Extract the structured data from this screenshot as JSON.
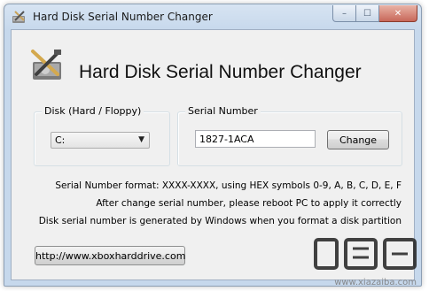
{
  "window": {
    "title": "Hard Disk Serial Number Changer",
    "controls": {
      "minimize": "–",
      "maximize": "☐",
      "close": "✕"
    }
  },
  "header": {
    "app_title": "Hard Disk Serial Number Changer",
    "icon": "hard-disk-tool-icon"
  },
  "drive_group": {
    "label": "Disk (Hard / Floppy)",
    "selected": "C:",
    "icon": "chevron-down-icon"
  },
  "serial_group": {
    "label": "Serial Number",
    "value": "1827-1ACA",
    "change_label": "Change"
  },
  "info": {
    "line1": "Serial Number format: XXXX-XXXX, using HEX symbols 0-9, A, B, C, D, E, F",
    "line2": "After change serial number, please reboot PC to apply it correctly",
    "line3": "Disk serial number is generated by Windows when you format a disk partition"
  },
  "footer": {
    "url_label": "http://www.xboxharddrive.com"
  },
  "watermark": {
    "text": "www.xiazaiba.com"
  },
  "colors": {
    "frame": "#c6d8ec",
    "client": "#f0f0f0",
    "close": "#c8685a"
  }
}
